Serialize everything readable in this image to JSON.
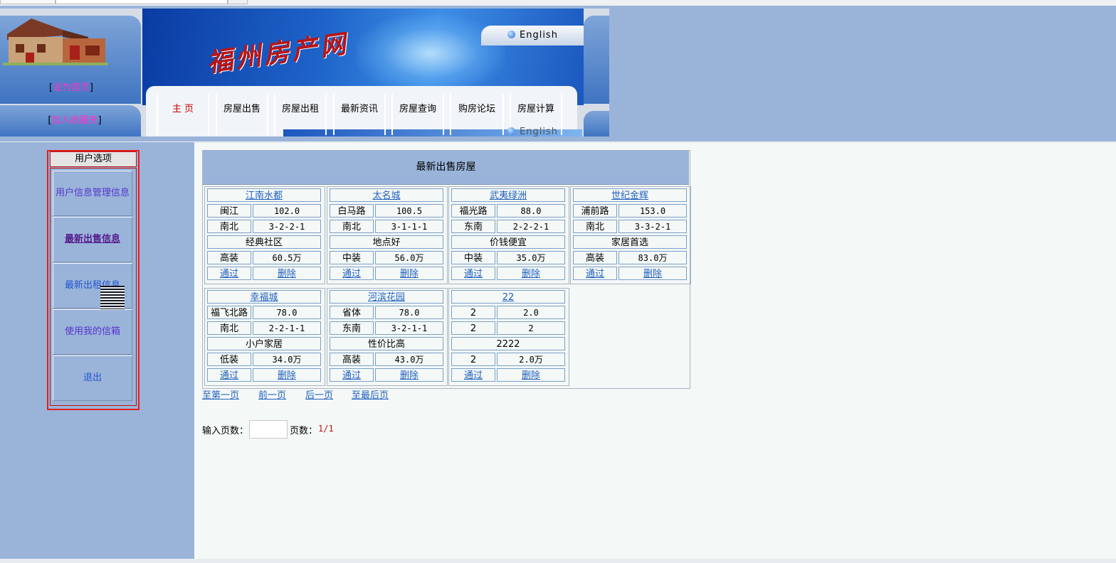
{
  "header": {
    "site_title": "福州房产网",
    "set_home_prefix": "[",
    "set_home_label": "设为首页",
    "set_home_suffix": "]",
    "add_fav_prefix": "[",
    "add_fav_label": "加入收藏夹",
    "add_fav_suffix": "]",
    "english_label": "English",
    "nav": [
      "主 页",
      "房屋出售",
      "房屋出租",
      "最新资讯",
      "房屋查询",
      "购房论坛",
      "房屋计算"
    ]
  },
  "sidebar": {
    "title": "用户选项",
    "items": [
      {
        "label": "用户信息管理信息"
      },
      {
        "label": "最新出售信息"
      },
      {
        "label": "最新出租信息"
      },
      {
        "label": "使用我的信箱"
      },
      {
        "label": "退出"
      }
    ]
  },
  "listing": {
    "title": "最新出售房屋",
    "approve_label": "通过",
    "delete_label": "删除",
    "cards": [
      {
        "name": "江南水都",
        "district": "闽江",
        "area": "102.0",
        "orientation": "南北",
        "layout": "3-2-2-1",
        "tag": "经典社区",
        "decoration": "高装",
        "price": "60.5万"
      },
      {
        "name": "太名城",
        "district": "白马路",
        "area": "100.5",
        "orientation": "南北",
        "layout": "3-1-1-1",
        "tag": "地点好",
        "decoration": "中装",
        "price": "56.0万"
      },
      {
        "name": "武夷绿洲",
        "district": "福光路",
        "area": "88.0",
        "orientation": "东南",
        "layout": "2-2-2-1",
        "tag": "价钱便宜",
        "decoration": "中装",
        "price": "35.0万"
      },
      {
        "name": "世纪金辉",
        "district": "浦前路",
        "area": "153.0",
        "orientation": "南北",
        "layout": "3-3-2-1",
        "tag": "家居首选",
        "decoration": "高装",
        "price": "83.0万"
      },
      {
        "name": "幸福城",
        "district": "福飞北路",
        "area": "78.0",
        "orientation": "南北",
        "layout": "2-2-1-1",
        "tag": "小户家居",
        "decoration": "低装",
        "price": "34.0万"
      },
      {
        "name": "河滨花园",
        "district": "省体",
        "area": "78.0",
        "orientation": "东南",
        "layout": "3-2-1-1",
        "tag": "性价比高",
        "decoration": "高装",
        "price": "43.0万"
      },
      {
        "name": "22",
        "district": "2",
        "area": "2.0",
        "orientation": "2",
        "layout": "2",
        "tag": "2222",
        "decoration": "2",
        "price": "2.0万"
      }
    ]
  },
  "paging": {
    "first": "至第一页",
    "prev": "前一页",
    "next": "后一页",
    "last": "至最后页",
    "input_label": "输入页数：",
    "input_value": "",
    "count_label": "页数：",
    "count_value": "1/1"
  },
  "colors": {
    "page_bg": "#f4f8f6",
    "sidebar_bg": "#9ab4d9",
    "link": "#1f5fbf",
    "accent_red": "#e02020",
    "banner_blue": "#1e63c8"
  }
}
